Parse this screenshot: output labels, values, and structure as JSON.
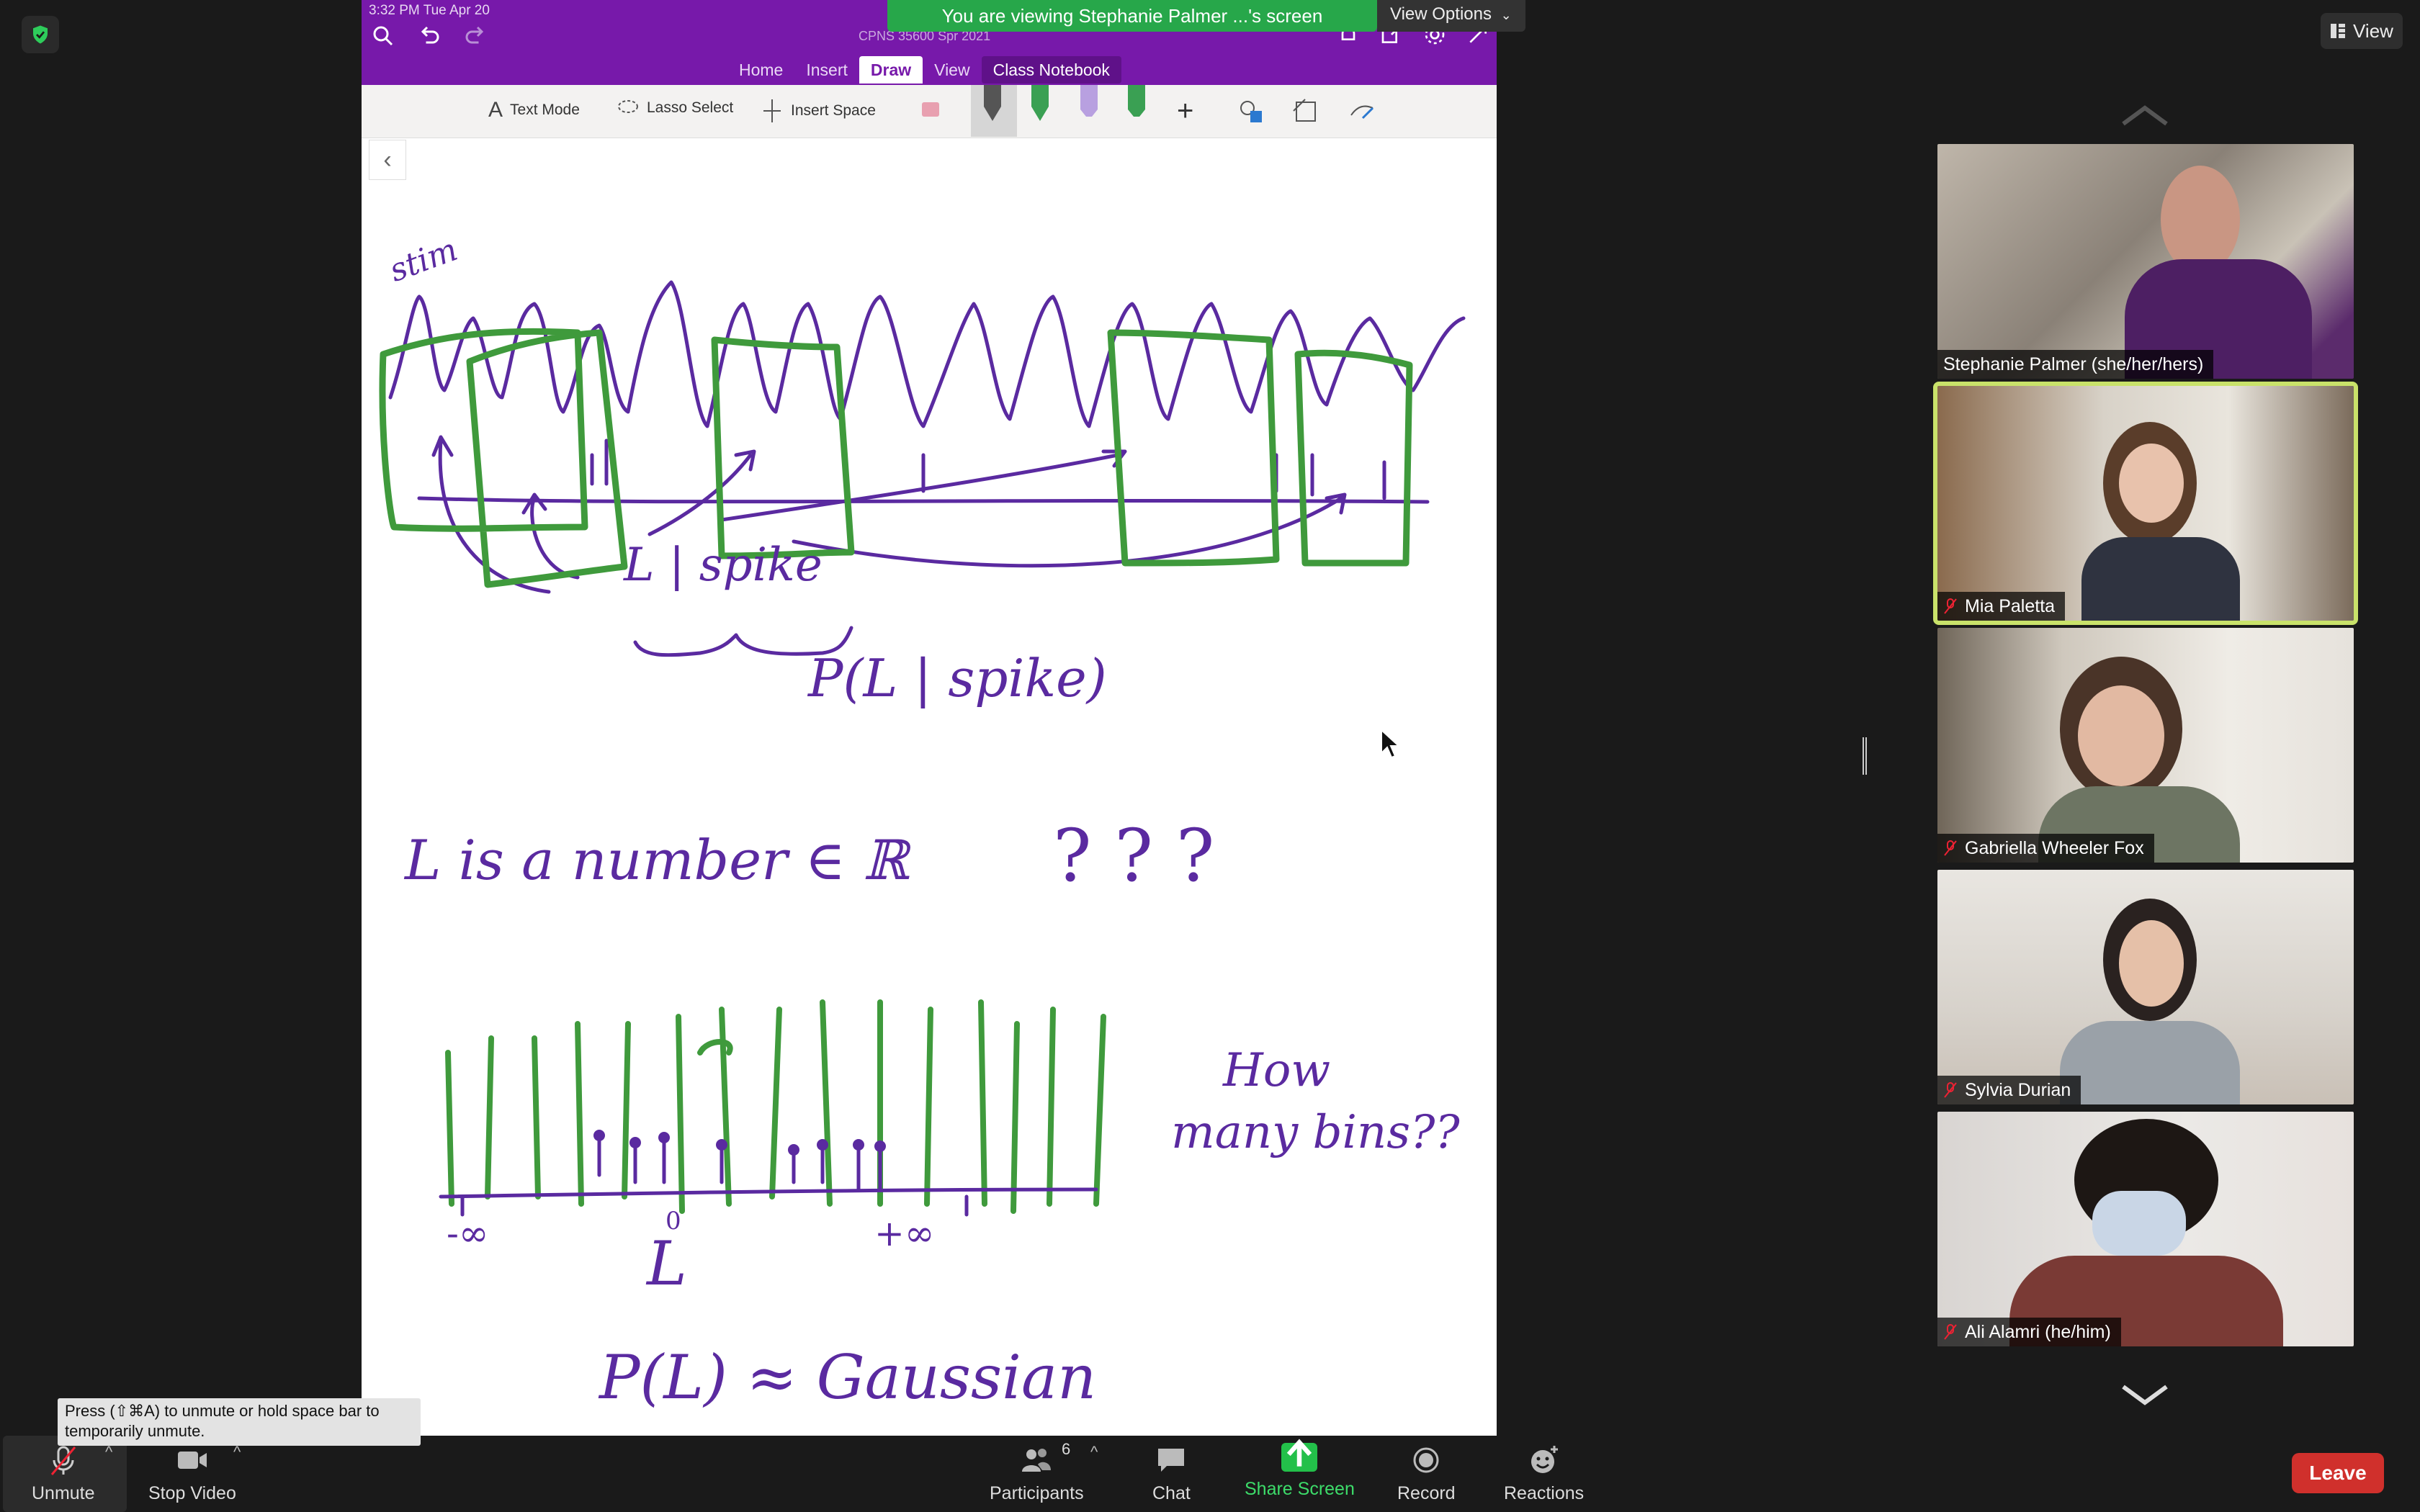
{
  "banner": {
    "text": "You are viewing Stephanie Palmer ...'s screen",
    "view_options": "View Options"
  },
  "top_right": {
    "view_label": "View"
  },
  "onenote": {
    "status_time": "3:32 PM   Tue Apr 20",
    "notebook_title": "CPNS 35600 Spr 2021",
    "tabs": [
      "Home",
      "Insert",
      "Draw",
      "View",
      "Class Notebook"
    ],
    "active_tab": "Draw",
    "ribbon": {
      "text_mode": "Text Mode",
      "lasso_select": "Lasso Select",
      "insert_space": "Insert Space"
    },
    "pen_colors": [
      "#e8a0b0",
      "#555555",
      "#3aa053",
      "#b8a0e0",
      "#3aa053"
    ]
  },
  "handwriting": {
    "l_spike": "L | spike",
    "p_l_spike": "P(L | spike)",
    "l_number": "L is a number ∈ ℝ",
    "question_marks": "? ? ?",
    "neg_inf": "-∞",
    "zero": "0",
    "pos_inf": "+∞",
    "l_axis": "L",
    "how_many_bins_1": "How",
    "how_many_bins_2": "many bins??",
    "p_l_gaussian": "P(L) ≈ Gaussian",
    "stim_label": "stim"
  },
  "participants_tiles": [
    {
      "name": "Stephanie Palmer (she/her/hers)",
      "muted": false,
      "active": false
    },
    {
      "name": "Mia Paletta",
      "muted": true,
      "active": true
    },
    {
      "name": "Gabriella Wheeler Fox",
      "muted": true,
      "active": false
    },
    {
      "name": "Sylvia Durian",
      "muted": true,
      "active": false
    },
    {
      "name": "Ali Alamri (he/him)",
      "muted": true,
      "active": false
    }
  ],
  "toolbar": {
    "unmute": "Unmute",
    "stop_video": "Stop Video",
    "participants": "Participants",
    "participants_count": "6",
    "chat": "Chat",
    "share_screen": "Share Screen",
    "record": "Record",
    "reactions": "Reactions",
    "leave": "Leave"
  },
  "tooltip": {
    "text": "Press  (⇧⌘A) to unmute or hold space bar to temporarily unmute."
  },
  "colors": {
    "onenote_purple": "#7719aa",
    "ink_purple": "#5a2aa0",
    "ink_green": "#3f9a3c",
    "banner_green": "#27a74a",
    "leave_red": "#d0302c",
    "active_speaker": "#c9e26a"
  }
}
